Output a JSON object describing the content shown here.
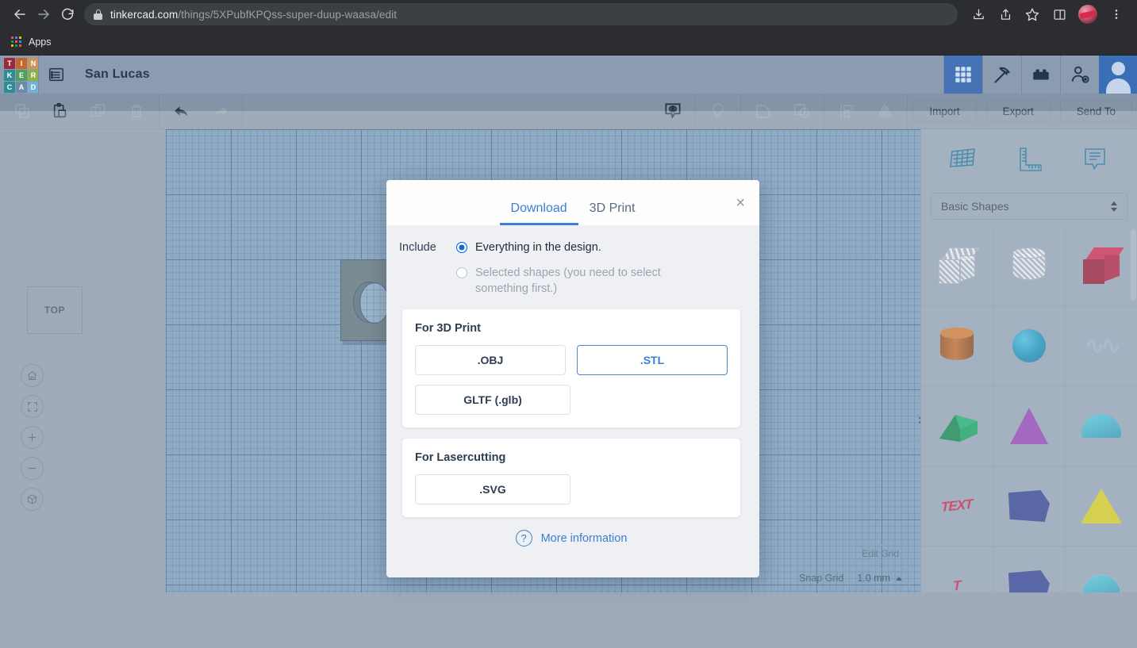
{
  "browser": {
    "url_domain": "tinkercad.com",
    "url_path": "/things/5XPubfKPQss-super-duup-waasa/edit",
    "bookmark_apps_label": "Apps",
    "icons": {
      "back": "back-arrow-icon",
      "forward": "forward-arrow-icon",
      "reload": "reload-icon",
      "lock": "lock-icon",
      "download": "download-icon",
      "share": "share-icon",
      "bookmark": "star-icon",
      "sidebar": "sidebar-panel-icon",
      "profile": "profile-avatar-icon",
      "menu": "three-dot-menu-icon"
    }
  },
  "header": {
    "logo_letters": [
      "T",
      "I",
      "N",
      "K",
      "E",
      "R",
      "C",
      "A",
      "D"
    ],
    "logo_colors": [
      "#9c2a3a",
      "#c4672c",
      "#cc9456",
      "#2f8c96",
      "#4fa05c",
      "#8bb04a",
      "#2f8c96",
      "#6f8aa8",
      "#72b2d8"
    ],
    "design_title": "San Lucas",
    "right_icons": [
      {
        "name": "grid-gallery-icon",
        "active": true
      },
      {
        "name": "codeblocks-pickaxe-icon",
        "active": false
      },
      {
        "name": "blocks-brick-icon",
        "active": false
      },
      {
        "name": "invite-person-icon",
        "active": false
      }
    ],
    "avatar": "user-avatar"
  },
  "toolbar": {
    "left_icons": [
      {
        "name": "copy-icon",
        "enabled": false
      },
      {
        "name": "paste-icon",
        "enabled": true
      },
      {
        "name": "duplicate-icon",
        "enabled": false
      },
      {
        "name": "delete-trash-icon",
        "enabled": false
      }
    ],
    "history_icons": [
      {
        "name": "undo-icon",
        "enabled": true
      },
      {
        "name": "redo-icon",
        "enabled": false
      }
    ],
    "center_icons": [
      {
        "name": "visibility-eye-icon",
        "enabled": true
      },
      {
        "name": "lightbulb-hint-icon",
        "enabled": false
      },
      {
        "name": "group-icon",
        "enabled": false
      },
      {
        "name": "ungroup-icon",
        "enabled": false
      },
      {
        "name": "align-icon",
        "enabled": false
      },
      {
        "name": "mirror-icon",
        "enabled": false
      }
    ],
    "buttons": [
      {
        "label": "Import",
        "name": "import-button"
      },
      {
        "label": "Export",
        "name": "export-button"
      },
      {
        "label": "Send To",
        "name": "send-to-button"
      }
    ]
  },
  "viewport": {
    "view_cube_label": "TOP",
    "nav_buttons": [
      {
        "name": "home-view-button",
        "glyph": "home"
      },
      {
        "name": "fit-to-view-button",
        "glyph": "fit"
      },
      {
        "name": "zoom-in-button",
        "glyph": "plus"
      },
      {
        "name": "zoom-out-button",
        "glyph": "minus"
      },
      {
        "name": "perspective-toggle-button",
        "glyph": "cube"
      }
    ],
    "edit_grid_label": "Edit Grid",
    "snap_grid_label": "Snap Grid",
    "snap_grid_value": "1.0 mm",
    "collapse_panel_glyph": "›"
  },
  "right_panel": {
    "tool_icons": [
      {
        "name": "workplane-icon"
      },
      {
        "name": "ruler-icon"
      },
      {
        "name": "note-icon"
      }
    ],
    "library_select": "Basic Shapes",
    "shapes": [
      {
        "name": "box-hole-shape",
        "kind": "cube",
        "color": "#c4ccd6",
        "hole": true
      },
      {
        "name": "cylinder-hole-shape",
        "kind": "cylinder",
        "color": "#c4ccd6",
        "hole": true
      },
      {
        "name": "box-shape",
        "kind": "cube",
        "color": "#a51d3d",
        "hole": false
      },
      {
        "name": "cylinder-shape",
        "kind": "cylinder",
        "color": "#b5662c",
        "hole": false
      },
      {
        "name": "sphere-shape",
        "kind": "sphere",
        "color": "#1389b4",
        "hole": false
      },
      {
        "name": "scribble-shape",
        "kind": "scribble",
        "color": "#8fa8c4",
        "hole": false
      },
      {
        "name": "roof-wedge-shape",
        "kind": "wedge",
        "color": "#0f9a5c",
        "hole": false
      },
      {
        "name": "cone-shape",
        "kind": "cone",
        "color": "#8a3fb0",
        "hole": false
      },
      {
        "name": "dome-shape",
        "kind": "dome",
        "color": "#2fa5c0",
        "hole": false
      },
      {
        "name": "text-shape",
        "kind": "text",
        "color": "#c21f45",
        "label": "TEXT",
        "hole": false
      },
      {
        "name": "polygon-prism-shape",
        "kind": "prism",
        "color": "#2b3d8f",
        "hole": false
      },
      {
        "name": "pyramid-shape",
        "kind": "pyramid",
        "color": "#c9c322",
        "hole": false
      },
      {
        "name": "text-shape-2",
        "kind": "text",
        "color": "#c21f45",
        "label": "T",
        "hole": false
      },
      {
        "name": "polygon-prism-shape-2",
        "kind": "prism",
        "color": "#2b3d8f",
        "hole": false
      },
      {
        "name": "dome-hole-shape",
        "kind": "dome",
        "color": "#c4ccd6",
        "hole": true
      }
    ]
  },
  "modal": {
    "tabs": [
      {
        "label": "Download",
        "active": true
      },
      {
        "label": "3D Print",
        "active": false
      }
    ],
    "close_glyph": "×",
    "include_label": "Include",
    "options": [
      {
        "label": "Everything in the design.",
        "selected": true,
        "disabled": false
      },
      {
        "label": "Selected shapes (you need to select something first.)",
        "selected": false,
        "disabled": true
      }
    ],
    "print_section": {
      "title": "For 3D Print",
      "buttons": [
        {
          "label": ".OBJ",
          "selected": false
        },
        {
          "label": ".STL",
          "selected": true
        },
        {
          "label": "GLTF (.glb)",
          "selected": false
        }
      ]
    },
    "laser_section": {
      "title": "For Lasercutting",
      "buttons": [
        {
          "label": ".SVG",
          "selected": false
        }
      ]
    },
    "more_info_label": "More information",
    "more_info_icon": "question-circle-icon",
    "accent_color": "#3b7fd4"
  }
}
